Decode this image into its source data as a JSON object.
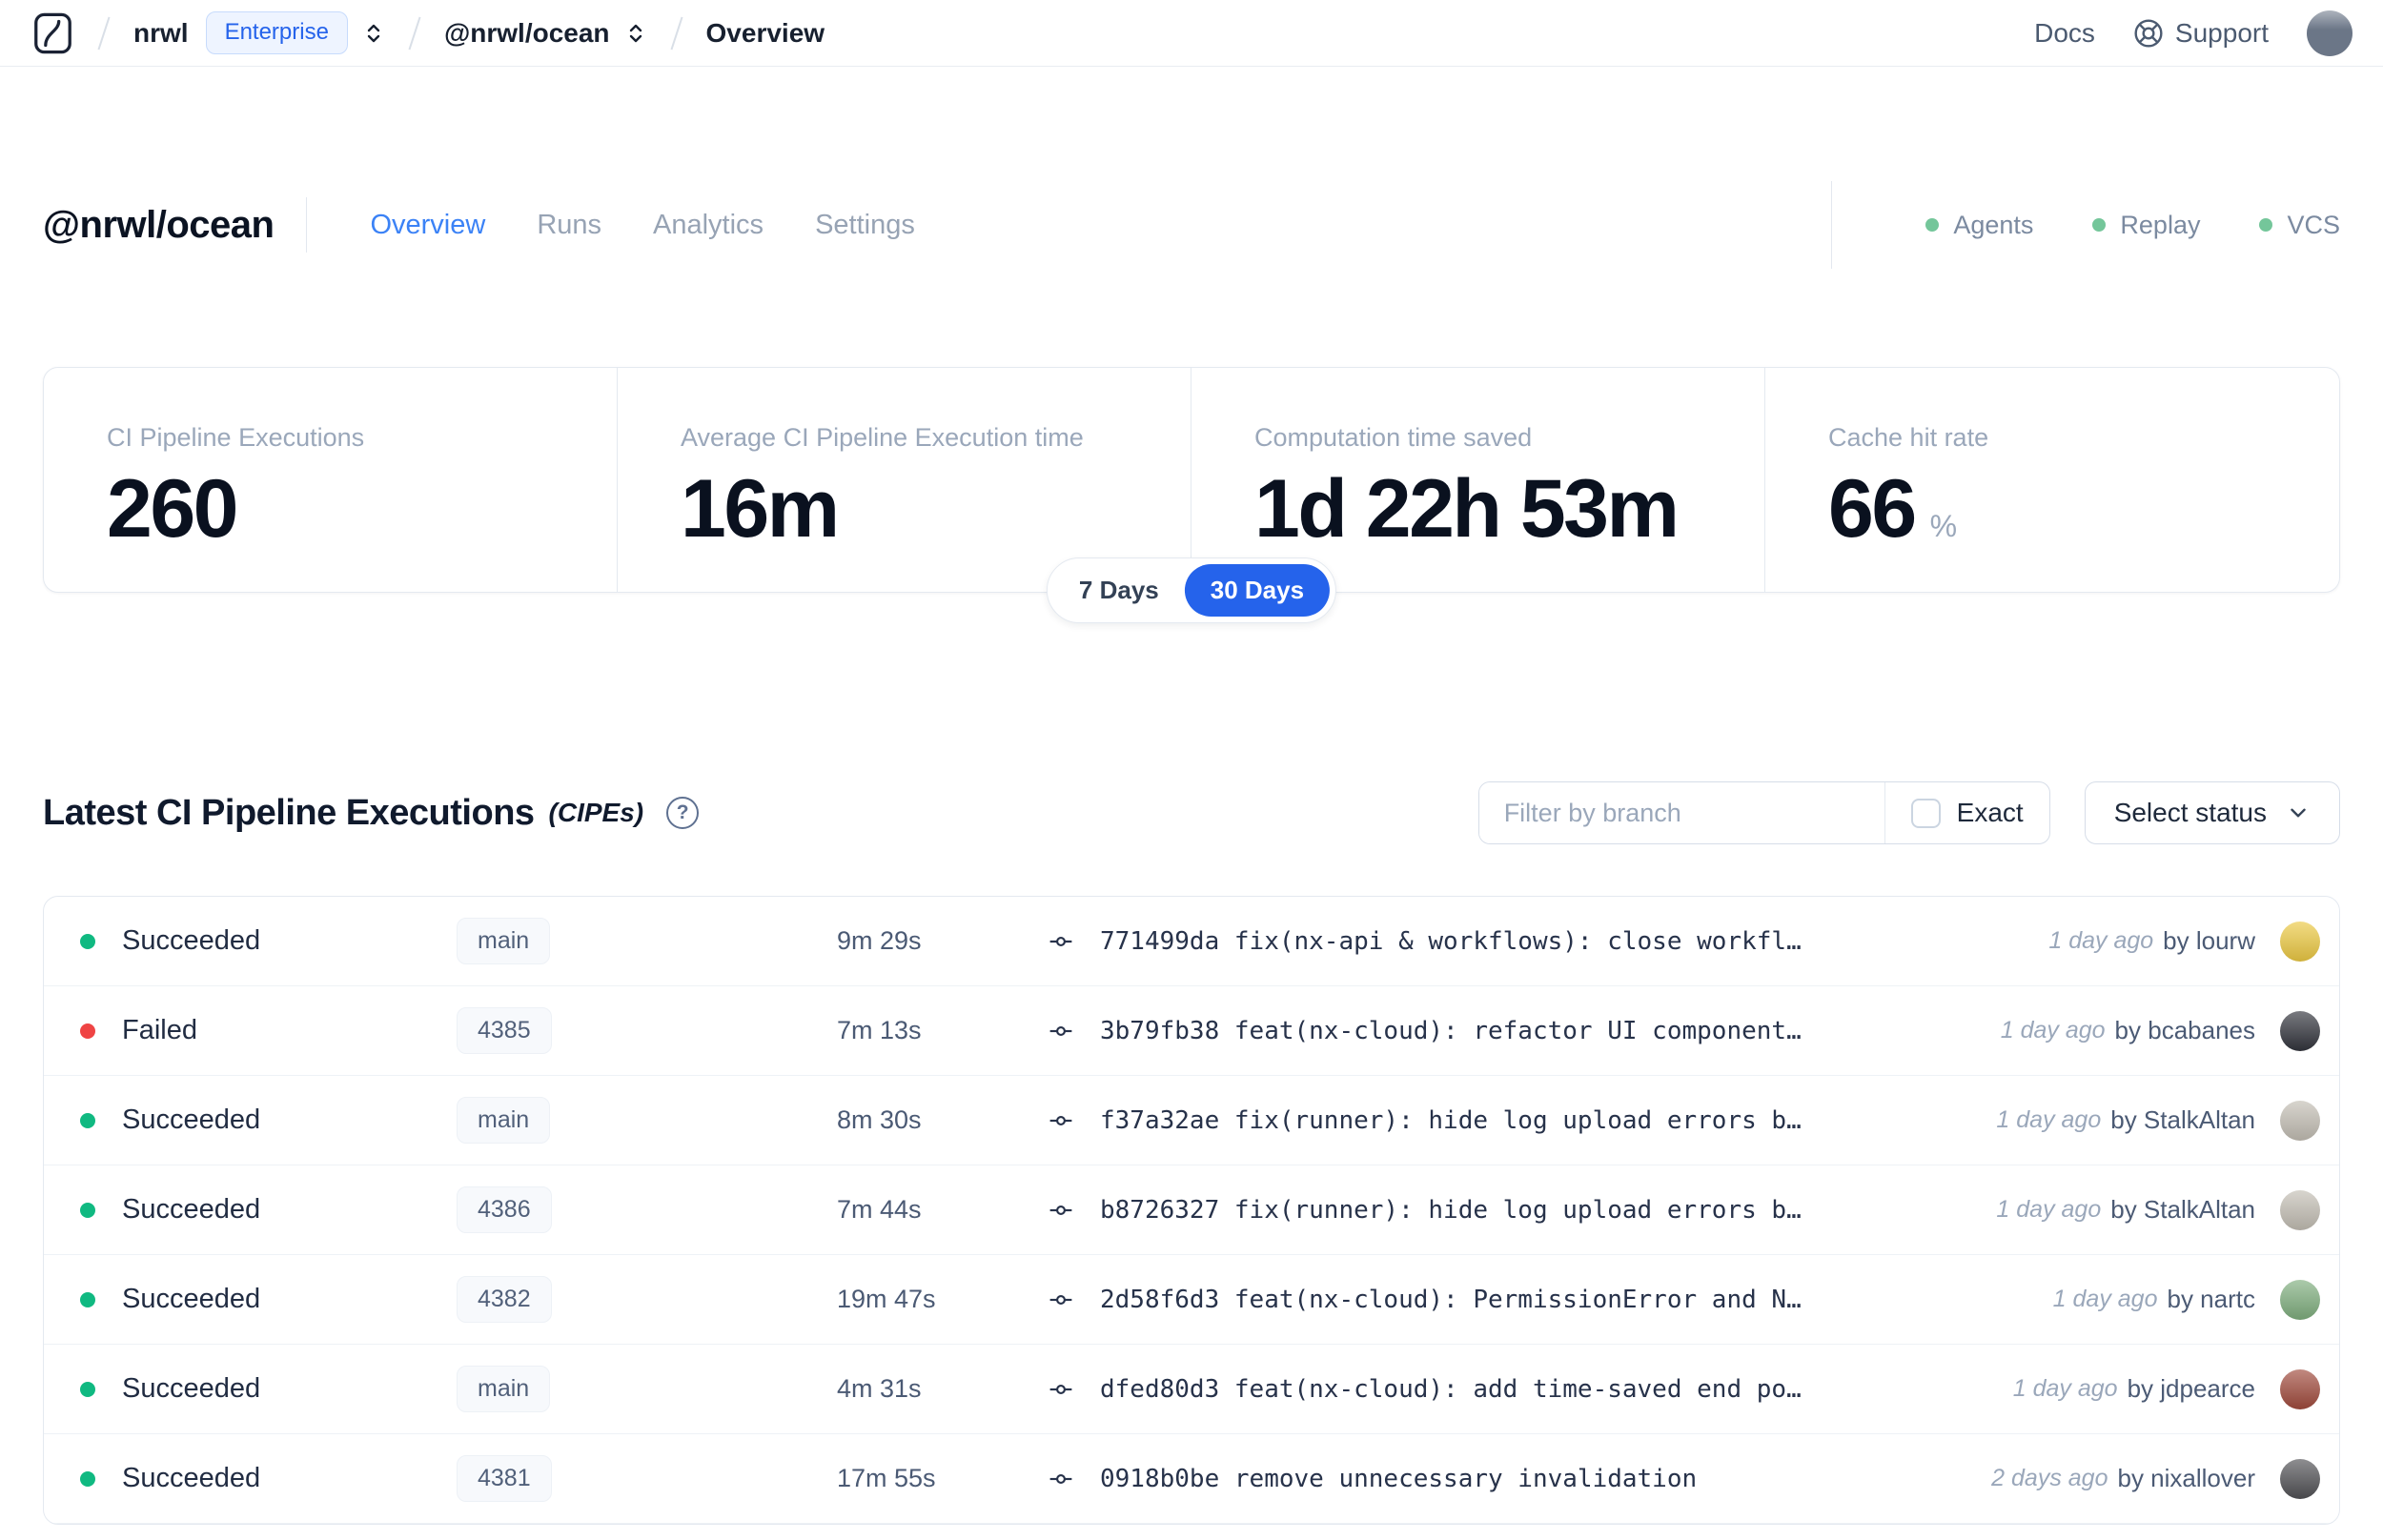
{
  "topbar": {
    "org": "nrwl",
    "org_badge": "Enterprise",
    "workspace": "@nrwl/ocean",
    "page": "Overview",
    "docs_label": "Docs",
    "support_label": "Support",
    "avatar_color": "#6b7687"
  },
  "workspace_header": {
    "title": "@nrwl/ocean",
    "tabs": [
      {
        "label": "Overview",
        "active": true
      },
      {
        "label": "Runs",
        "active": false
      },
      {
        "label": "Analytics",
        "active": false
      },
      {
        "label": "Settings",
        "active": false
      }
    ],
    "indicators": [
      {
        "label": "Agents",
        "status_color": "#74c69a"
      },
      {
        "label": "Replay",
        "status_color": "#74c69a"
      },
      {
        "label": "VCS",
        "status_color": "#74c69a"
      }
    ]
  },
  "stats": {
    "cards": [
      {
        "label": "CI Pipeline Executions",
        "value": "260"
      },
      {
        "label": "Average CI Pipeline Execution time",
        "value": "16m"
      },
      {
        "label": "Computation time saved",
        "value": "1d 22h 53m"
      },
      {
        "label": "Cache hit rate",
        "value": "66",
        "unit": "%"
      }
    ],
    "range_toggle": {
      "options": [
        "7 Days",
        "30 Days"
      ],
      "selected": "30 Days"
    }
  },
  "cipe_section": {
    "title": "Latest CI Pipeline Executions",
    "title_suffix": "(CIPEs)",
    "filter": {
      "branch_placeholder": "Filter by branch",
      "exact_label": "Exact",
      "status_label": "Select status"
    },
    "rows": [
      {
        "status": "Succeeded",
        "status_color": "green",
        "branch": "main",
        "duration": "9m 29s",
        "commit_hash": "771499da",
        "commit_message": "fix(nx-api & workflows): close workfl…",
        "time_ago": "1 day ago",
        "author": "by lourw",
        "avatar_color": "#ecc943"
      },
      {
        "status": "Failed",
        "status_color": "red",
        "branch": "4385",
        "duration": "7m 13s",
        "commit_hash": "3b79fb38",
        "commit_message": "feat(nx-cloud): refactor UI component…",
        "time_ago": "1 day ago",
        "author": "by bcabanes",
        "avatar_color": "#32343c"
      },
      {
        "status": "Succeeded",
        "status_color": "green",
        "branch": "main",
        "duration": "8m 30s",
        "commit_hash": "f37a32ae",
        "commit_message": "fix(runner): hide log upload errors b…",
        "time_ago": "1 day ago",
        "author": "by StalkAltan",
        "avatar_color": "#c3beb4"
      },
      {
        "status": "Succeeded",
        "status_color": "green",
        "branch": "4386",
        "duration": "7m 44s",
        "commit_hash": "b8726327",
        "commit_message": "fix(runner): hide log upload errors b…",
        "time_ago": "1 day ago",
        "author": "by StalkAltan",
        "avatar_color": "#c3beb4"
      },
      {
        "status": "Succeeded",
        "status_color": "green",
        "branch": "4382",
        "duration": "19m 47s",
        "commit_hash": "2d58f6d3",
        "commit_message": "feat(nx-cloud): PermissionError and N…",
        "time_ago": "1 day ago",
        "author": "by nartc",
        "avatar_color": "#7fae7e"
      },
      {
        "status": "Succeeded",
        "status_color": "green",
        "branch": "main",
        "duration": "4m 31s",
        "commit_hash": "dfed80d3",
        "commit_message": "feat(nx-cloud): add time-saved end po…",
        "time_ago": "1 day ago",
        "author": "by jdpearce",
        "avatar_color": "#a04a3c"
      },
      {
        "status": "Succeeded",
        "status_color": "green",
        "branch": "4381",
        "duration": "17m 55s",
        "commit_hash": "0918b0be",
        "commit_message": "remove unnecessary invalidation",
        "time_ago": "2 days ago",
        "author": "by nixallover",
        "avatar_color": "#515155"
      }
    ]
  },
  "icons": {
    "logo": "nx-cloud-logo",
    "breadcrumb_switcher": "chevrons-up-down",
    "support": "life-buoy",
    "section_help": "question-circle",
    "commit": "git-commit",
    "status_select": "chevron-down"
  },
  "colors": {
    "accent_blue": "#2563eb",
    "tab_active_blue": "#3b82f6",
    "success_green": "#10b981",
    "failed_red": "#ef4444",
    "indicator_green": "#74c69a"
  }
}
